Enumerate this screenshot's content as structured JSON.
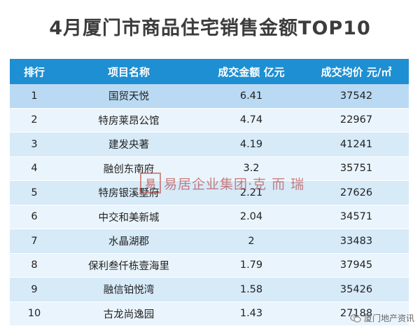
{
  "title": "4月厦门市商品住宅销售金额TOP10",
  "table": {
    "headers": {
      "rank": "排行",
      "name": "项目名称",
      "amount": "成交金额  亿元",
      "price": "成交均价  元/㎡"
    },
    "rows": [
      {
        "rank": "1",
        "name": "国贸天悦",
        "amount": "6.41",
        "price": "37542"
      },
      {
        "rank": "2",
        "name": "特房莱昂公馆",
        "amount": "4.74",
        "price": "22967"
      },
      {
        "rank": "3",
        "name": "建发央著",
        "amount": "4.19",
        "price": "41241"
      },
      {
        "rank": "4",
        "name": "融创东南府",
        "amount": "3.2",
        "price": "35751"
      },
      {
        "rank": "5",
        "name": "特房银溪墅府",
        "amount": "2.21",
        "price": "27626"
      },
      {
        "rank": "6",
        "name": "中交和美新城",
        "amount": "2.04",
        "price": "34571"
      },
      {
        "rank": "7",
        "name": "水晶湖郡",
        "amount": "2",
        "price": "33483"
      },
      {
        "rank": "8",
        "name": "保利叁仟栋壹海里",
        "amount": "1.79",
        "price": "37945"
      },
      {
        "rank": "9",
        "name": "融信铂悦湾",
        "amount": "1.58",
        "price": "35426"
      },
      {
        "rank": "10",
        "name": "古龙尚逸园",
        "amount": "1.43",
        "price": "27188"
      }
    ]
  },
  "watermark": {
    "seal": "易",
    "text": "易居企业集团·克 而 瑞"
  },
  "footer": {
    "brand": "厦门地产资讯"
  },
  "colors": {
    "header_bg": "#1e8fd2",
    "row_odd": "#d6eaf8",
    "row_even": "#eaf4fc",
    "row_highlight": "#b9daf2"
  }
}
